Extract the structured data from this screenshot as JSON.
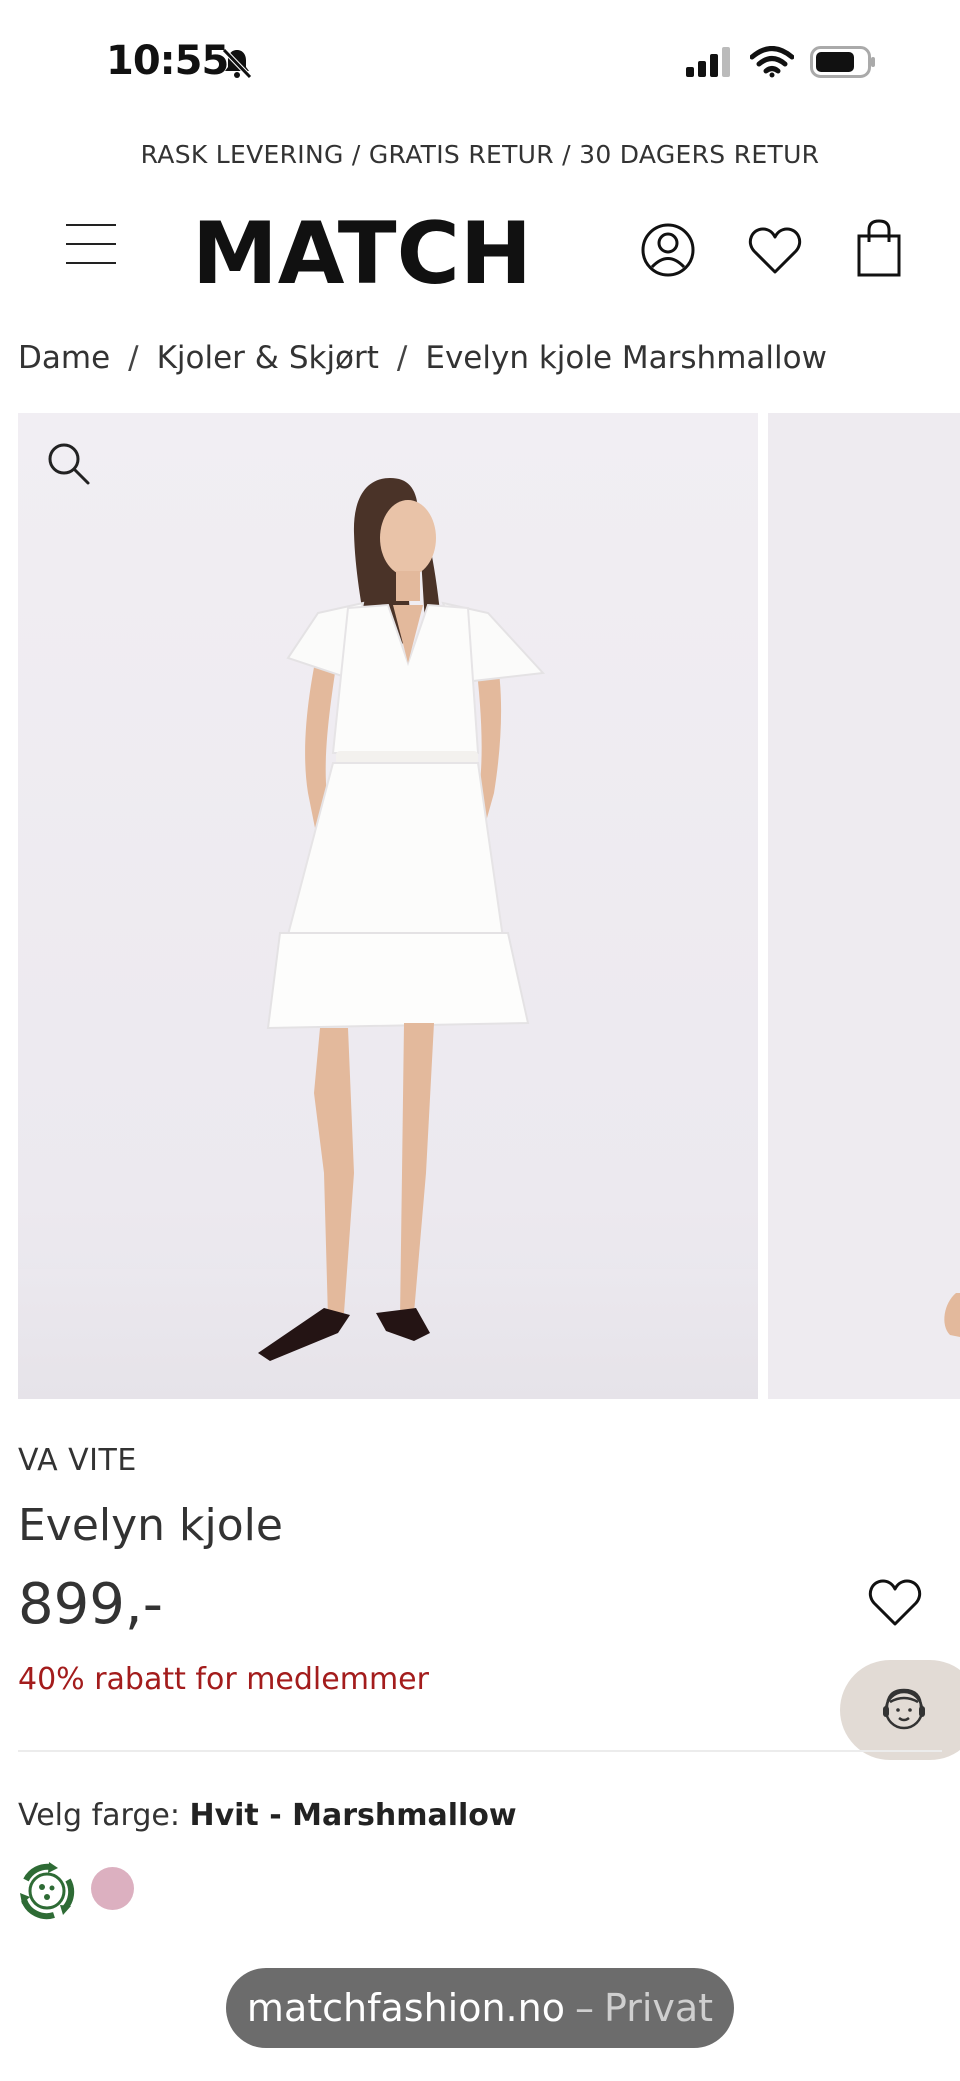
{
  "status_bar": {
    "time": "10:55",
    "icons": [
      "bell-muted-icon",
      "signal-icon",
      "wifi-icon",
      "battery-icon"
    ]
  },
  "promo_banner": "RASK LEVERING / GRATIS RETUR / 30 DAGERS RETUR",
  "header": {
    "logo": "MATCH",
    "icons": [
      "menu-icon",
      "account-icon",
      "heart-icon",
      "bag-icon"
    ]
  },
  "breadcrumb": {
    "items": [
      "Dame",
      "Kjoler & Skjørt",
      "Evelyn kjole Marshmallow"
    ],
    "separator": "/"
  },
  "product": {
    "brand": "VA VITE",
    "name": "Evelyn kjole",
    "price": "899,-",
    "member_offer": "40% rabatt for medlemmer",
    "color_label": "Velg farge:",
    "color_value": "Hvit - Marshmallow",
    "swatches": [
      {
        "name": "eco-swatch",
        "color": "#2e6b35"
      },
      {
        "name": "pink-swatch",
        "color": "#dcb0c0"
      }
    ]
  },
  "colors": {
    "accent_red": "#a31c1c",
    "chat_bubble": "#e2dbd5",
    "url_pill": "#6c6c6c"
  },
  "browser": {
    "domain": "matchfashion.no",
    "dash": "–",
    "mode": "Privat"
  }
}
